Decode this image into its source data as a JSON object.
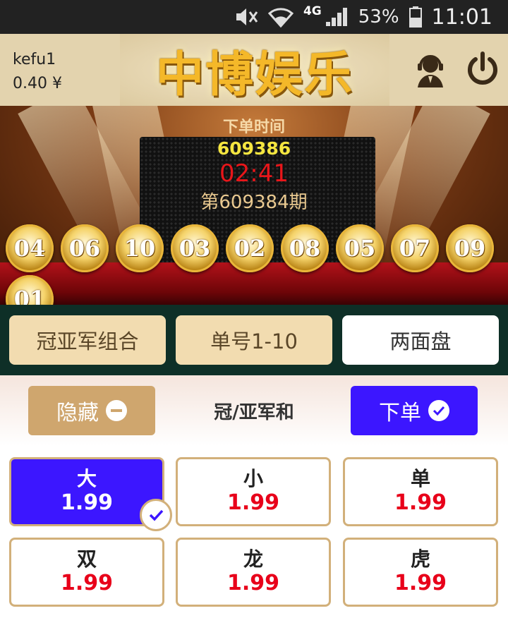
{
  "status_bar": {
    "network": "4G",
    "battery": "53%",
    "time": "11:01"
  },
  "header": {
    "username": "kefu1",
    "balance": "0.40 ¥",
    "brand": "中博娱乐"
  },
  "draw": {
    "label": "下单时间",
    "issue_number": "609386",
    "countdown": "02:41",
    "period": "第609384期",
    "balls": [
      "04",
      "06",
      "10",
      "03",
      "02",
      "08",
      "05",
      "07",
      "09",
      "01"
    ]
  },
  "tabs": [
    {
      "label": "冠亚军组合",
      "active": false
    },
    {
      "label": "单号1-10",
      "active": false
    },
    {
      "label": "两面盘",
      "active": true
    }
  ],
  "controls": {
    "hide_label": "隐藏",
    "section_title": "冠/亚军和",
    "order_label": "下单"
  },
  "bets": [
    {
      "name": "大",
      "odds": "1.99",
      "selected": true
    },
    {
      "name": "小",
      "odds": "1.99",
      "selected": false
    },
    {
      "name": "单",
      "odds": "1.99",
      "selected": false
    },
    {
      "name": "双",
      "odds": "1.99",
      "selected": false
    },
    {
      "name": "龙",
      "odds": "1.99",
      "selected": false
    },
    {
      "name": "虎",
      "odds": "1.99",
      "selected": false
    }
  ],
  "colors": {
    "accent": "#3c16ff",
    "gold": "#cfa66e",
    "odds": "#e8001a",
    "tab_bg": "#0e2f27"
  }
}
